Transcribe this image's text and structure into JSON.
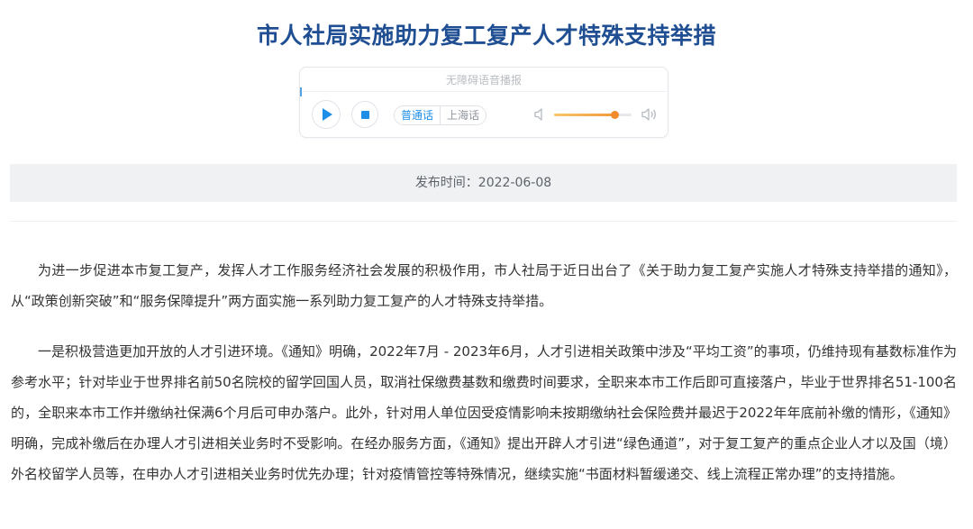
{
  "article": {
    "title": "市人社局实施助力复工复产人才特殊支持举措",
    "publish_label": "发布时间：2022-06-08",
    "paragraphs": [
      "为进一步促进本市复工复产，发挥人才工作服务经济社会发展的积极作用，市人社局于近日出台了《关于助力复工复产实施人才特殊支持举措的通知》，从“政策创新突破”和“服务保障提升”两方面实施一系列助力复工复产的人才特殊支持举措。",
      "一是积极营造更加开放的人才引进环境。《通知》明确，2022年7月 - 2023年6月，人才引进相关政策中涉及“平均工资”的事项，仍维持现有基数标准作为参考水平；针对毕业于世界排名前50名院校的留学回国人员，取消社保缴费基数和缴费时间要求，全职来本市工作后即可直接落户，毕业于世界排名51-100名的，全职来本市工作并缴纳社保满6个月后可申办落户。此外，针对用人单位因受疫情影响未按期缴纳社会保险费并最迟于2022年年底前补缴的情形，《通知》明确，完成补缴后在办理人才引进相关业务时不受影响。在经办服务方面，《通知》提出开辟人才引进“绿色通道”，对于复工复产的重点企业人才以及国（境）外名校留学人员等，在申办人才引进相关业务时优先办理；针对疫情管控等特殊情况，继续实施“书面材料暂缓递交、线上流程正常办理”的支持措施。"
    ]
  },
  "player": {
    "title": "无障碍语音播报",
    "languages": [
      "普通话",
      "上海话"
    ],
    "selected_language": "普通话",
    "volume": 0.78,
    "icons": {
      "play": "play-icon",
      "stop": "stop-icon",
      "volume_low": "volume-low-icon",
      "volume_high": "volume-high-icon"
    },
    "accent_color": "#1e8ee6",
    "volume_color": "#f08a2b"
  },
  "colors": {
    "title": "#1f4e92",
    "date_bar_bg": "#eff1f3",
    "body_text": "#333333"
  }
}
